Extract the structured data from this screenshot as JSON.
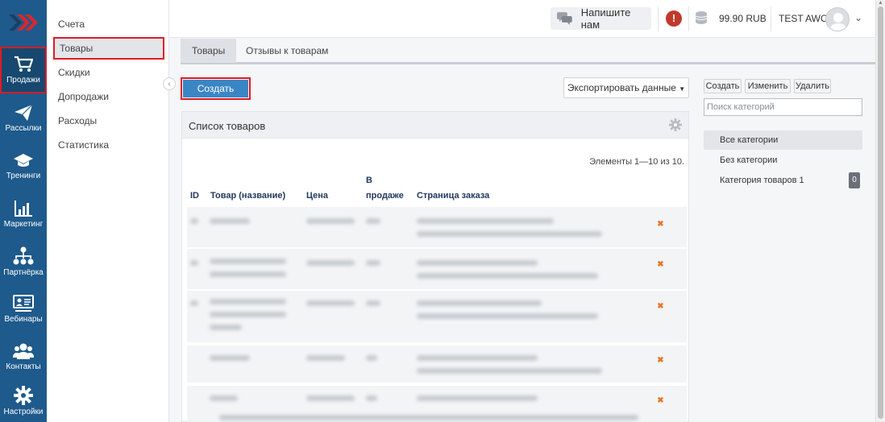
{
  "rail": {
    "items": [
      {
        "label": "Продажи",
        "icon": "cart-icon",
        "active": true
      },
      {
        "label": "Рассылки",
        "icon": "paper-plane-icon"
      },
      {
        "label": "Тренинги",
        "icon": "graduation-cap-icon"
      },
      {
        "label": "Маркетинг",
        "icon": "bar-chart-icon"
      },
      {
        "label": "Партнёрка",
        "icon": "network-icon"
      },
      {
        "label": "Вебинары",
        "icon": "presentation-icon"
      },
      {
        "label": "Контакты",
        "icon": "users-icon"
      },
      {
        "label": "Настройки",
        "icon": "gear-icon"
      }
    ]
  },
  "submenu": {
    "items": [
      {
        "label": "Счета"
      },
      {
        "label": "Товары",
        "active": true
      },
      {
        "label": "Скидки"
      },
      {
        "label": "Допродажи"
      },
      {
        "label": "Расходы"
      },
      {
        "label": "Статистика"
      }
    ]
  },
  "header": {
    "chat_label": "Напишите нам",
    "alert_symbol": "!",
    "balance": "99.90 RUB",
    "user_name": "TEST AWO"
  },
  "tabs": [
    {
      "label": "Товары",
      "active": true
    },
    {
      "label": "Отзывы к товарам"
    }
  ],
  "main": {
    "create_label": "Создать",
    "export_label": "Экспортировать данные"
  },
  "products": {
    "title": "Список товаров",
    "count_text": "Элементы 1—10 из 10.",
    "columns": {
      "id": "ID",
      "name": "Товар (название)",
      "price": "Цена",
      "on_sale_line1": "В",
      "on_sale_line2": "продаже",
      "order_page": "Страница заказа"
    },
    "row_count_visible": 5
  },
  "categories": {
    "create_label": "Создать",
    "edit_label": "Изменить",
    "delete_label": "Удалить",
    "search_placeholder": "Поиск категорий",
    "items": [
      {
        "label": "Все категории",
        "active": true
      },
      {
        "label": "Без категории"
      },
      {
        "label": "Категория товаров 1",
        "badge": "0"
      }
    ]
  },
  "colors": {
    "rail_bg": "#1e5a8c",
    "accent_blue": "#3a86c4",
    "highlight_red": "#e01b24",
    "delete_orange": "#e8752a"
  }
}
